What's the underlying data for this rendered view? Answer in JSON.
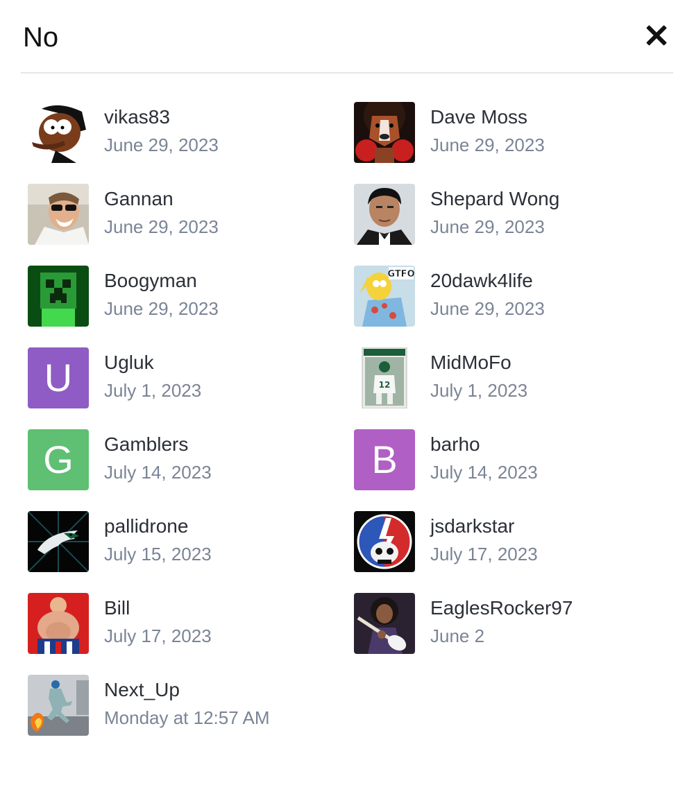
{
  "modal": {
    "title": "No",
    "close_icon": "close-icon"
  },
  "reactions": [
    {
      "username": "vikas83",
      "date": "June 29, 2023",
      "avatar": {
        "type": "image",
        "icon": "cartoon-character-avatar"
      }
    },
    {
      "username": "Dave Moss",
      "date": "June 29, 2023",
      "avatar": {
        "type": "image",
        "icon": "boxer-dog-avatar"
      }
    },
    {
      "username": "Gannan",
      "date": "June 29, 2023",
      "avatar": {
        "type": "image",
        "icon": "laughing-man-sunglasses-avatar"
      }
    },
    {
      "username": "Shepard Wong",
      "date": "June 29, 2023",
      "avatar": {
        "type": "image",
        "icon": "man-in-tuxedo-avatar"
      }
    },
    {
      "username": "Boogyman",
      "date": "June 29, 2023",
      "avatar": {
        "type": "image",
        "icon": "creeper-avatar"
      }
    },
    {
      "username": "20dawk4life",
      "date": "June 29, 2023",
      "avatar": {
        "type": "image",
        "icon": "cartoon-gtfo-avatar"
      }
    },
    {
      "username": "Ugluk",
      "date": "July 1, 2023",
      "avatar": {
        "type": "letter",
        "letter": "U",
        "color": "#8e5cc4"
      }
    },
    {
      "username": "MidMoFo",
      "date": "July 1, 2023",
      "avatar": {
        "type": "image",
        "icon": "football-card-avatar"
      }
    },
    {
      "username": "Gamblers",
      "date": "July 14, 2023",
      "avatar": {
        "type": "letter",
        "letter": "G",
        "color": "#5fbf72"
      }
    },
    {
      "username": "barho",
      "date": "July 14, 2023",
      "avatar": {
        "type": "letter",
        "letter": "B",
        "color": "#b05fc4"
      }
    },
    {
      "username": "pallidrone",
      "date": "July 15, 2023",
      "avatar": {
        "type": "image",
        "icon": "eagle-logo-avatar"
      }
    },
    {
      "username": "jsdarkstar",
      "date": "July 17, 2023",
      "avatar": {
        "type": "image",
        "icon": "steal-your-face-avatar"
      }
    },
    {
      "username": "Bill",
      "date": "July 17, 2023",
      "avatar": {
        "type": "image",
        "icon": "wrestler-avatar"
      }
    },
    {
      "username": "EaglesRocker97",
      "date": "June 2",
      "avatar": {
        "type": "image",
        "icon": "guitarist-avatar"
      }
    },
    {
      "username": "Next_Up",
      "date": "Monday at 12:57 AM",
      "avatar": {
        "type": "image",
        "icon": "running-man-avatar"
      }
    }
  ]
}
